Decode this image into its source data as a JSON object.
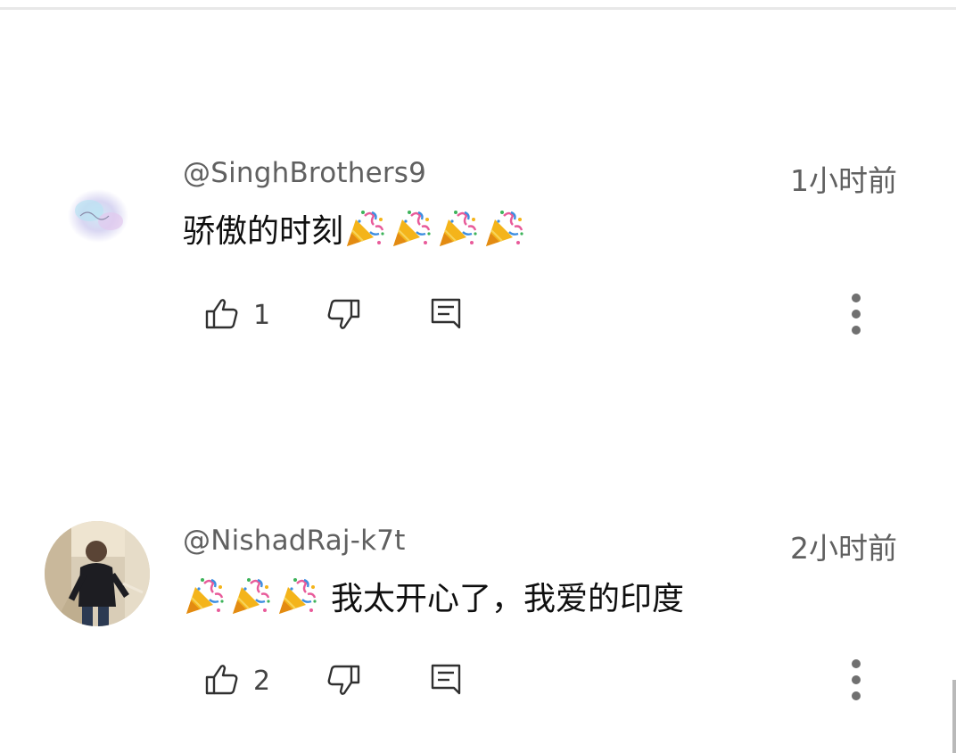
{
  "comments": [
    {
      "author": "@SinghBrothers9",
      "time": "1小时前",
      "text_before_emoji": "骄傲的时刻",
      "text_after_emoji": "",
      "emoji": "party-popper",
      "emoji_count": 4,
      "likes": "1"
    },
    {
      "author": "@NishadRaj-k7t",
      "time": "2小时前",
      "text_before_emoji": "",
      "text_after_emoji": "我太开心了，我爱的印度",
      "emoji": "party-popper",
      "emoji_count": 3,
      "likes": "2"
    }
  ],
  "icons": {
    "like": "thumbs-up-icon",
    "dislike": "thumbs-down-icon",
    "reply": "reply-comment-icon",
    "more": "more-vertical-icon"
  },
  "colors": {
    "author": "#606060",
    "text": "#0f0f0f",
    "icon": "#303030"
  }
}
